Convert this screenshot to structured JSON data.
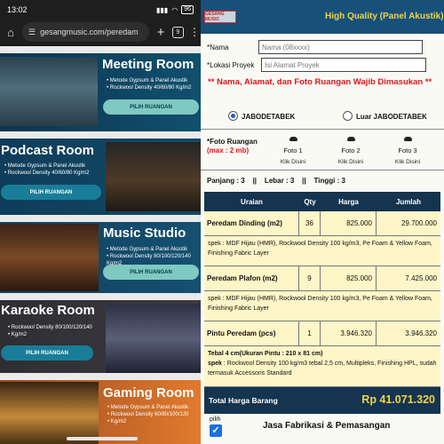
{
  "phone": {
    "status": {
      "time": "13:02",
      "battery": "96"
    },
    "browser": {
      "url": "gesangmusic.com/peredam",
      "tab_count": "9"
    },
    "rooms": [
      {
        "title": "Meeting Room",
        "specs": [
          "Metode Gypsum & Panel Akustik",
          "Rockwool Density 40/60/80 Kg/m2"
        ],
        "button": "PILIH RUANGAN"
      },
      {
        "title": "Podcast Room",
        "specs": [
          "Metode Gypsum & Panel Akustik",
          "Rockwool Density 40/60/80 Kg/m2"
        ],
        "button": "PILIH RUANGAN"
      },
      {
        "title": "Music Studio",
        "specs": [
          "Metode Gypsum & Panel Akustik",
          "Rockwool Density 80/100/120/140 Kg/m2"
        ],
        "button": "PILIH RUANGAN"
      },
      {
        "title": "Karaoke Room",
        "specs": [
          "Rockwool Density 80/100/120/140",
          "Kg/m2"
        ],
        "button": "PILIH RUANGAN"
      },
      {
        "title": "Gaming Room",
        "specs": [
          "Metode Gypsum & Panel Akustik",
          "Rockwool Density 60/80/100/120",
          "Kg/m2"
        ]
      }
    ]
  },
  "form": {
    "header_title": "High Quality (Panel Akustik)",
    "logo_text": "GESANG MUSIC",
    "nama_label": "*Nama",
    "nama_placeholder": "Nama (08xxxx)",
    "lokasi_label": "*Lokasi Proyek",
    "lokasi_placeholder": "Isi Alamat Proyek",
    "warning": "** Nama, Alamat, dan Foto Ruangan Wajib Dimasukan **",
    "region_options": [
      "JABODETABEK",
      "Luar JABODETABEK"
    ],
    "selected_region": "JABODETABEK",
    "foto_label": "*Foto Ruangan",
    "foto_max": "(max : 2 mb)",
    "fotos": [
      {
        "label": "Foto 1",
        "action": "Klik Disini"
      },
      {
        "label": "Foto 2",
        "action": "Klik Disini"
      },
      {
        "label": "Foto 3",
        "action": "Klik Disini"
      }
    ],
    "dimensions": "Panjang : 3    ||    Lebar : 3    ||    Tinggi : 3",
    "table": {
      "headers": [
        "Uraian",
        "Qty",
        "Harga",
        "Jumlah"
      ],
      "rows": [
        {
          "item": "Peredam Dinding (m2)",
          "qty": "36",
          "price": "825.000",
          "total": "29.700.000"
        },
        {
          "item": "Peredam Plafon (m2)",
          "qty": "9",
          "price": "825.000",
          "total": "7.425.000"
        },
        {
          "item": "Pintu Peredam (pcs)",
          "qty": "1",
          "price": "3.946.320",
          "total": "3.946.320"
        }
      ],
      "spec1": "spek : MDF Hijau (HMR), Rockwool Density 100 kg/m3, Pe Foam & Yellow Foam, Finishing Fabric Layer",
      "spec2": "spek : MDF Hijau (HMR), Rockwool Density 100 kg/m3, Pe Foam & Yellow Foam, Finishing Fabric Layer",
      "door_spec_title": "Tebal 4 cm(Ukuran Pintu : 210 x 81 cm)",
      "door_spec_label": "spek",
      "door_spec": " : Rockwool Density 100 kg/m3 tebal 2,5 cm, Multipleks, Finishing HPL, sudah termasuk Accessoris Standard"
    },
    "total_label": "Total Harga Barang",
    "total_value": "Rp 41.071.320",
    "pilih_label": "pilih",
    "service_label": "Jasa Fabrikasi & Pemasangan"
  }
}
